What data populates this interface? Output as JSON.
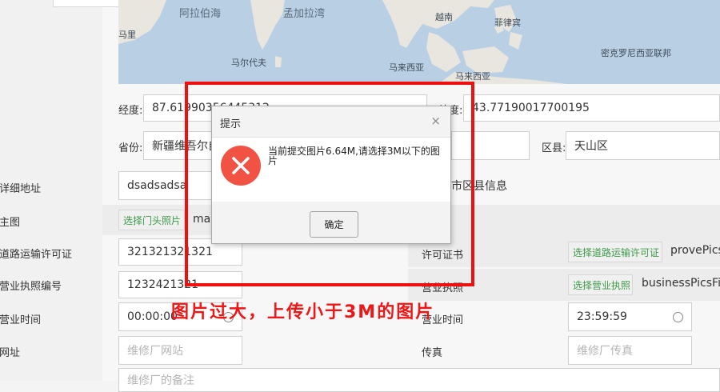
{
  "map": {
    "labels": [
      "阿拉伯海",
      "孟加拉湾",
      "越南",
      "菲律宾",
      "马里",
      "马尔代夫",
      "马来西亚",
      "马来西亚",
      "密克罗尼西亚联邦"
    ]
  },
  "left_labels": [
    "详细地址",
    "主图",
    "道路运输许可证",
    "营业执照编号",
    "营业时间",
    "网址"
  ],
  "location": {
    "lng_label": "经度:",
    "lng_value": "87.61990356445312",
    "lat_label": "纬度:",
    "lat_value": "43.77190017700195",
    "prov_label": "省份:",
    "prov_value": "新疆维吾尔自治区",
    "dist_label": "区县:",
    "dist_value": "天山区"
  },
  "address": {
    "value": "dsadsadsa",
    "region_hint": "市区县信息"
  },
  "main_image": {
    "chip": "选择门头照片",
    "filename": "mai"
  },
  "transport": {
    "value": "321321321321",
    "cert_label": "许可证书",
    "chip": "选择道路运输许可证",
    "filename": "provePics"
  },
  "license": {
    "value": "1232421321",
    "label": "营业执照",
    "chip": "选择营业执照",
    "filename": "businessPicsFil"
  },
  "hours": {
    "start": "00:00:00",
    "end": "23:59:59",
    "end_label": "营业时间"
  },
  "website": {
    "placeholder": "维修厂网站",
    "fax_label": "传真",
    "fax_placeholder": "维修厂传真"
  },
  "remark": {
    "placeholder": "维修厂的备注"
  },
  "dialog": {
    "title": "提示",
    "close": "×",
    "message": "当前提交图片6.64M,请选择3M以下的图片",
    "ok": "确定"
  },
  "annotation": {
    "caption": "图片过大，上传小于3M的图片"
  },
  "colors": {
    "error_red": "#f05243",
    "annotation_red": "#ee0f0f",
    "chip_green": "#3c9a48"
  }
}
